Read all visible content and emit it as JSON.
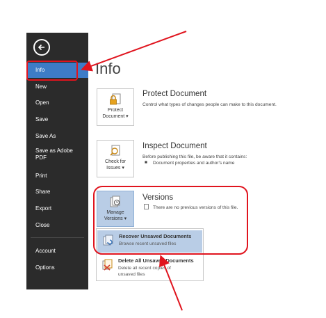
{
  "sidebar": {
    "items": [
      {
        "label": "Info"
      },
      {
        "label": "New"
      },
      {
        "label": "Open"
      },
      {
        "label": "Save"
      },
      {
        "label": "Save As"
      },
      {
        "label": "Save as Adobe PDF"
      },
      {
        "label": "Print"
      },
      {
        "label": "Share"
      },
      {
        "label": "Export"
      },
      {
        "label": "Close"
      },
      {
        "label": "Account"
      },
      {
        "label": "Options"
      }
    ]
  },
  "page": {
    "title": "Info"
  },
  "protect": {
    "button_line1": "Protect",
    "button_line2": "Document",
    "caret": "▾",
    "title": "Protect Document",
    "description": "Control what types of changes people can make to this document."
  },
  "inspect": {
    "button_line1": "Check for",
    "button_line2": "Issues",
    "caret": "▾",
    "title": "Inspect Document",
    "description": "Before publishing this file, be aware that it contains:",
    "bullet": "Document properties and author's name"
  },
  "versions": {
    "button_line1": "Manage",
    "button_line2": "Versions",
    "caret": "▾",
    "title": "Versions",
    "description": "There are no previous versions of this file."
  },
  "menu": {
    "recover": {
      "title": "Recover Unsaved Documents",
      "description": "Browse recent unsaved files"
    },
    "delete": {
      "title": "Delete All Unsaved Documents",
      "description_line1": "Delete all recent copies of",
      "description_line2": "unsaved files"
    }
  },
  "colors": {
    "sidebar_bg": "#2b2b2b",
    "active_item": "#3d7cc7",
    "highlight": "#b9cde6",
    "annotation": "#e0141e"
  },
  "icons": {
    "back": "back-arrow-icon",
    "protect": "lock-document-icon",
    "inspect": "inspect-document-icon",
    "versions": "manage-versions-icon",
    "recover": "recover-document-icon",
    "delete": "delete-document-icon"
  }
}
